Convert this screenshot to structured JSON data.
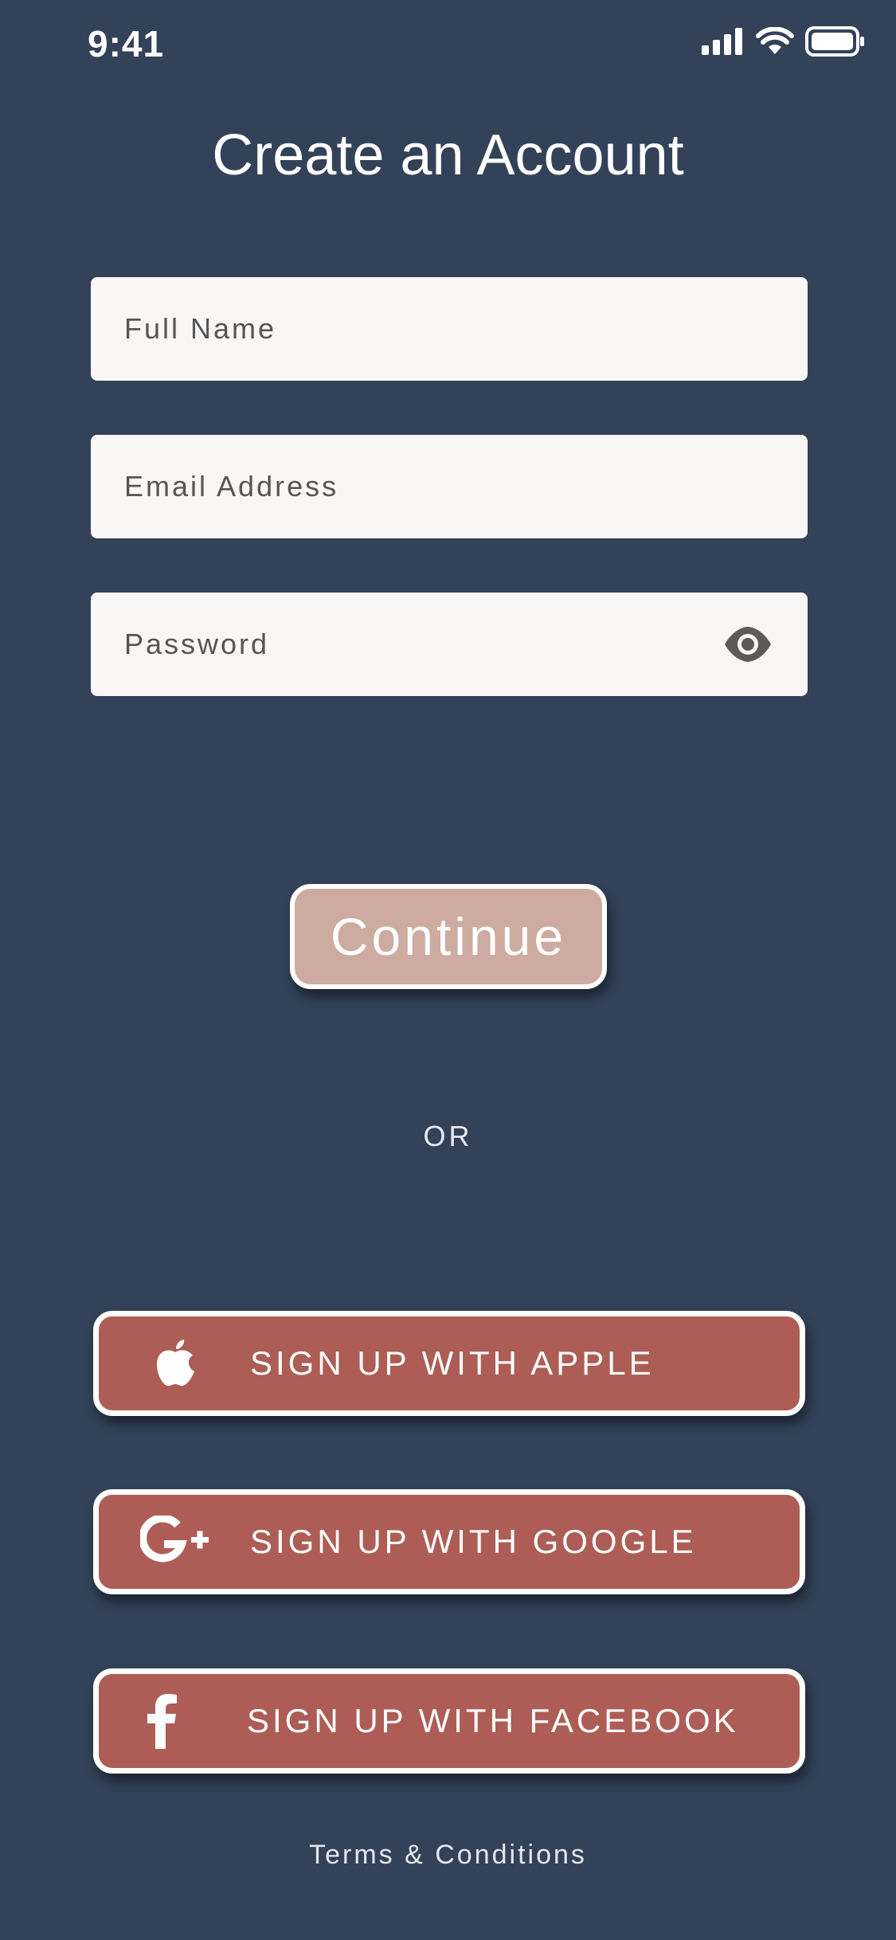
{
  "status_bar": {
    "time": "9:41"
  },
  "title": "Create an Account",
  "form": {
    "full_name": {
      "placeholder": "Full Name",
      "value": ""
    },
    "email": {
      "placeholder": "Email Address",
      "value": ""
    },
    "password": {
      "placeholder": "Password",
      "value": ""
    }
  },
  "continue_label": "Continue",
  "divider_label": "OR",
  "social": {
    "apple_label": "SIGN UP WITH APPLE",
    "google_label": "SIGN UP WITH GOOGLE",
    "facebook_label": "SIGN UP WITH FACEBOOK"
  },
  "terms_label": "Terms & Conditions",
  "icons": {
    "eye": "eye-icon",
    "apple": "apple-icon",
    "google": "google-plus-icon",
    "facebook": "facebook-icon"
  },
  "colors": {
    "background": "#334259",
    "field_background": "#f9f7f6",
    "continue_button": "#cdaba0",
    "social_button": "#ad5d55",
    "button_border": "#ffffff"
  }
}
